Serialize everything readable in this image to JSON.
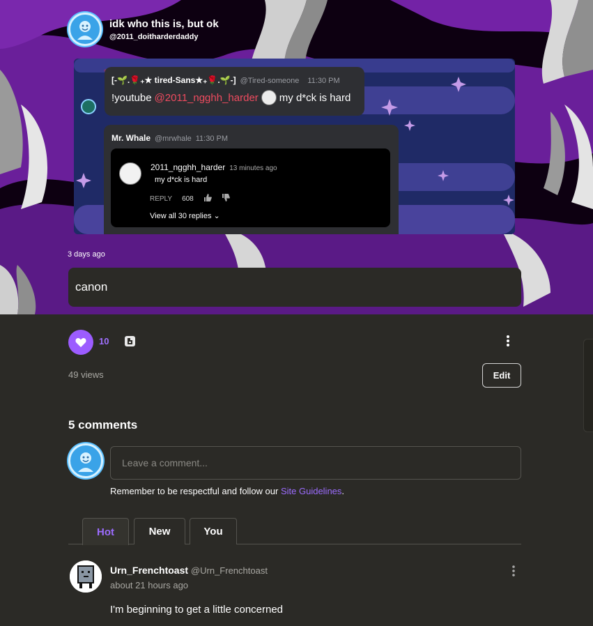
{
  "post": {
    "title": "idk who this is, but ok",
    "handle": "@2011_doitharderdaddy",
    "posted": "3 days ago",
    "caption": "canon",
    "likes": "10",
    "views": "49 views",
    "edit_label": "Edit"
  },
  "screenshot": {
    "msg1": {
      "name": "[-🌱.🌹₊★ tired-Sans★₊🌹.🌱-]",
      "handle": "@Tired-someone",
      "time": "11:30 PM",
      "text_a": "!youtube",
      "mention": "@2011_ngghh_harder",
      "text_b": "my d*ck is hard"
    },
    "msg2": {
      "name": "Mr. Whale",
      "handle": "@mrwhale",
      "time": "11:30 PM"
    },
    "yt": {
      "name": "2011_ngghh_harder",
      "ago": "13 minutes ago",
      "text": "my d*ck is hard",
      "reply": "REPLY",
      "count": "608",
      "view_all": "View all 30 replies"
    }
  },
  "comments": {
    "title": "5 comments",
    "placeholder": "Leave a comment...",
    "guidelines_prefix": "Remember to be respectful and follow our ",
    "guidelines_link": "Site Guidelines",
    "guidelines_suffix": ".",
    "tabs": [
      {
        "label": "Hot"
      },
      {
        "label": "New"
      },
      {
        "label": "You"
      }
    ],
    "items": [
      {
        "name": "Urn_Frenchtoast",
        "handle": "@Urn_Frenchtoast",
        "time": "about 21 hours ago",
        "text": "I'm beginning to get a little concerned"
      }
    ]
  },
  "colors": {
    "accent": "#9c5cff",
    "background": "#2b2a26",
    "mention": "#ef4b5f"
  }
}
